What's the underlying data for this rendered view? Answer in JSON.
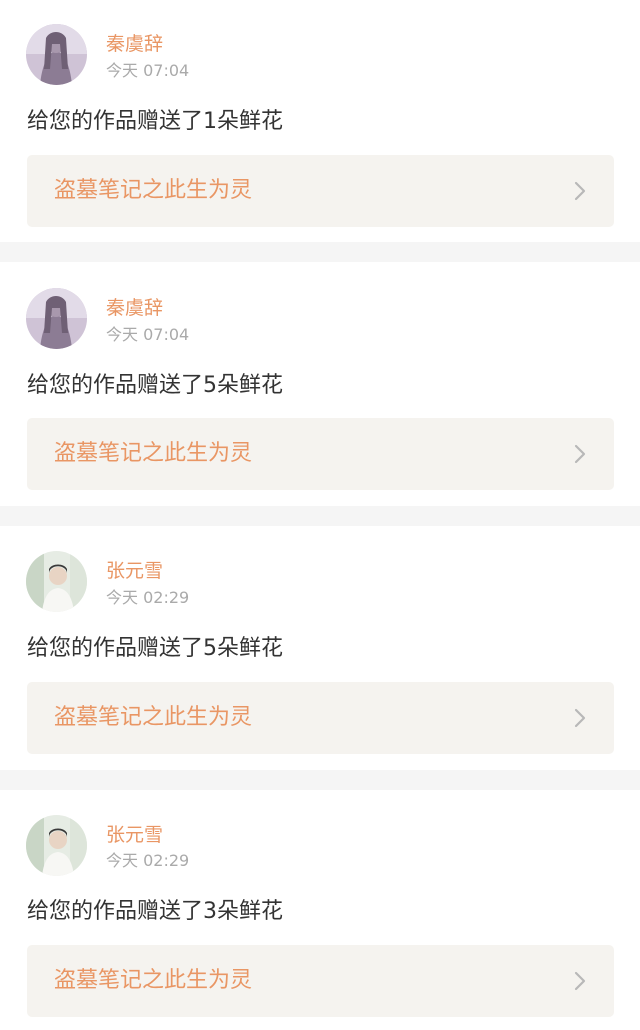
{
  "notifications": [
    {
      "avatar": "purple-portrait-avatar",
      "username": "秦虞辞",
      "time": "今天 07:04",
      "message": "给您的作品赠送了1朵鲜花",
      "work_title": "盗墓笔记之此生为灵",
      "chevron": "chevron-right-icon"
    },
    {
      "avatar": "purple-portrait-avatar",
      "username": "秦虞辞",
      "time": "今天 07:04",
      "message": "给您的作品赠送了5朵鲜花",
      "work_title": "盗墓笔记之此生为灵",
      "chevron": "chevron-right-icon"
    },
    {
      "avatar": "boy-portrait-avatar",
      "username": "张元雪",
      "time": "今天 02:29",
      "message": "给您的作品赠送了5朵鲜花",
      "work_title": "盗墓笔记之此生为灵",
      "chevron": "chevron-right-icon"
    },
    {
      "avatar": "boy-portrait-avatar",
      "username": "张元雪",
      "time": "今天 02:29",
      "message": "给您的作品赠送了3朵鲜花",
      "work_title": "盗墓笔记之此生为灵",
      "chevron": "chevron-right-icon"
    }
  ],
  "colors": {
    "accent": "#e99664",
    "time_gray": "#aaaaaa",
    "text": "#333333",
    "work_box_bg": "#f5f3ef",
    "separator_bg": "#f5f5f5"
  }
}
